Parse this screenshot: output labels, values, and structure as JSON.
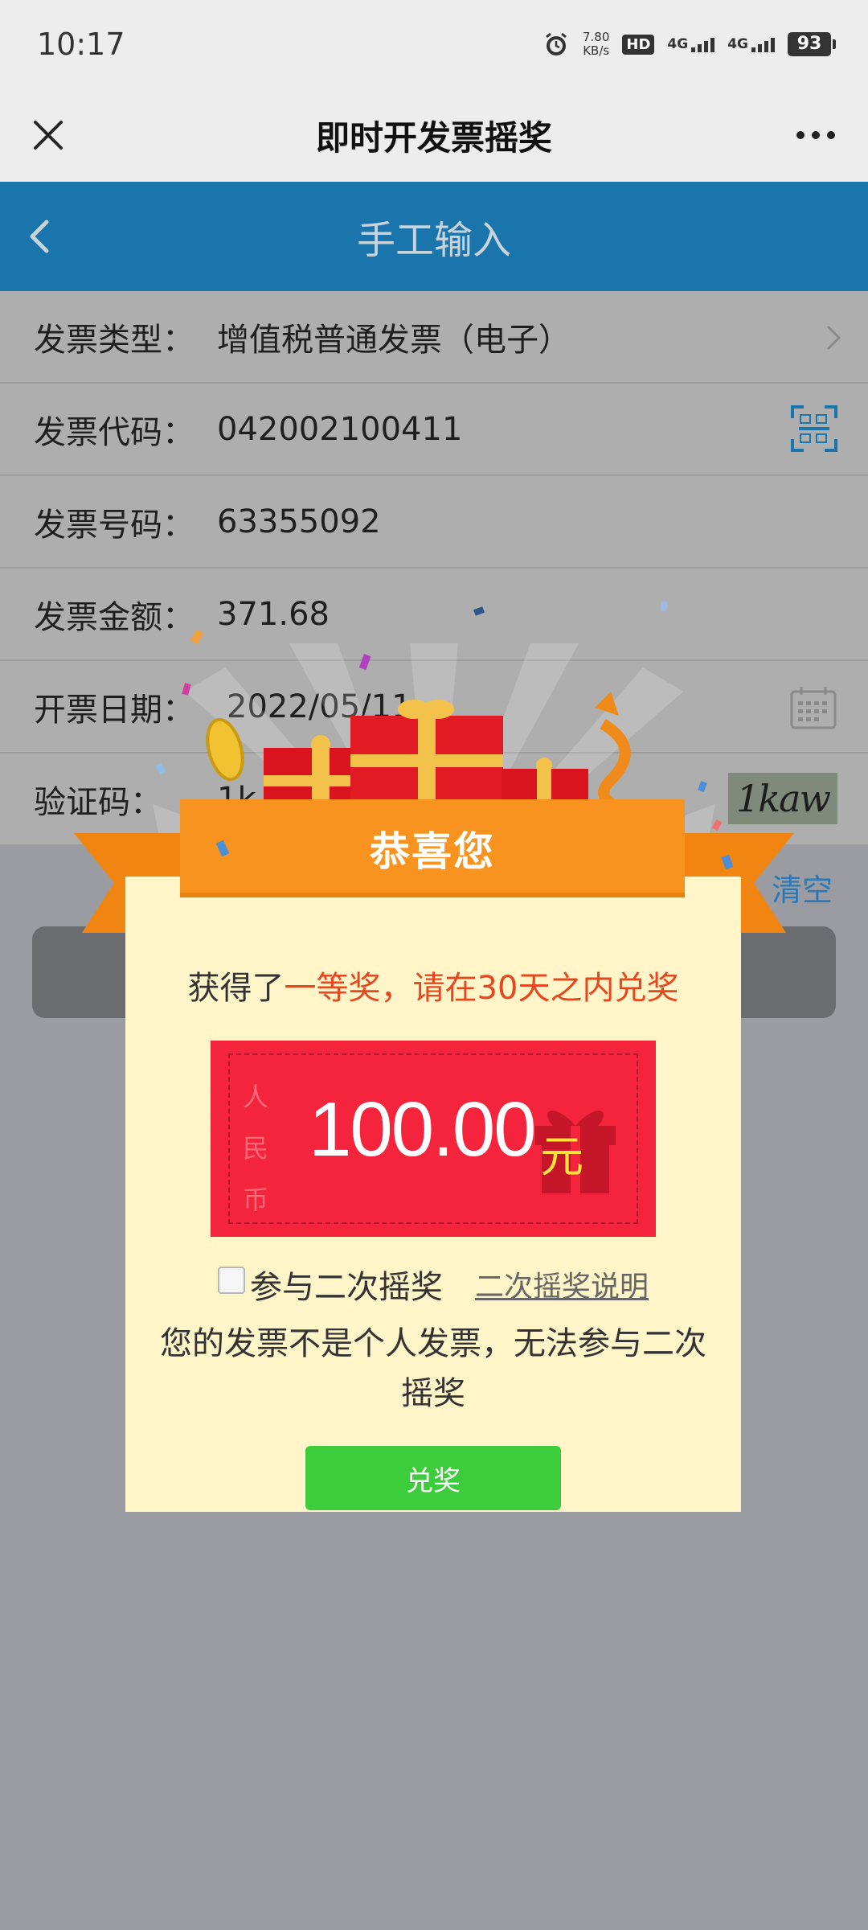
{
  "status_bar": {
    "time": "10:17",
    "speed_value": "7.80",
    "speed_unit": "KB/s",
    "hd_badge": "HD",
    "network_1": "4G",
    "network_2": "4G",
    "battery": "93"
  },
  "title_bar": {
    "title": "即时开发票摇奖",
    "close_icon": "close-icon",
    "more_icon": "more-icon"
  },
  "page_header": {
    "title": "手工输入",
    "back_icon": "chevron-left-icon"
  },
  "form": {
    "invoice_type": {
      "label": "发票类型：",
      "value": "增值税普通发票（电子）"
    },
    "invoice_code": {
      "label": "发票代码：",
      "value": "042002100411"
    },
    "invoice_number": {
      "label": "发票号码：",
      "value": "63355092"
    },
    "invoice_amount": {
      "label": "发票金额：",
      "value": "371.68"
    },
    "invoice_date": {
      "label": "开票日期：",
      "value": "2022/05/11"
    },
    "captcha": {
      "label": "验证码：",
      "value": "1k",
      "image_text": "1kaw"
    },
    "clear_label": "清空"
  },
  "popup": {
    "title": "恭喜您",
    "prize_prefix": "获得了",
    "prize_highlight": "一等奖，请在30天之内兑奖",
    "ticket": {
      "currency": [
        "人",
        "民",
        "币"
      ],
      "amount": "100.00",
      "unit": "元"
    },
    "second_draw_label": "参与二次摇奖",
    "second_draw_link": "二次摇奖说明",
    "notice": "您的发票不是个人发票，无法参与二次摇奖",
    "redeem_label": "兑奖"
  },
  "colors": {
    "header_blue": "#1b75ad",
    "ribbon_orange": "#f7931e",
    "ticket_red": "#f4243c",
    "highlight_red": "#e8461e",
    "button_green": "#3ccc3c",
    "modal_bg": "#fff5c9"
  }
}
